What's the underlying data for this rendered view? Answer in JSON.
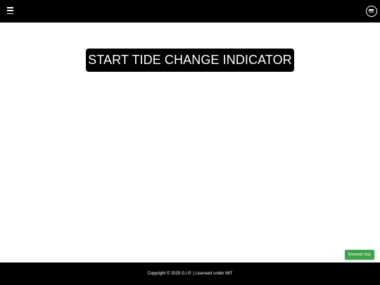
{
  "header": {
    "menu_icon": "hamburger-menu-icon",
    "logo_icon": "site-logo-icon"
  },
  "main": {
    "start_button_label": "START TIDE CHANGE INDICATOR"
  },
  "simulate": {
    "label": "Simulate Day",
    "color": "#3aa64a"
  },
  "footer": {
    "text": "Copyright © 2025 G.I.P. | Licensed under MIT"
  },
  "colors": {
    "bar": "#000000",
    "background": "#ffffff"
  }
}
